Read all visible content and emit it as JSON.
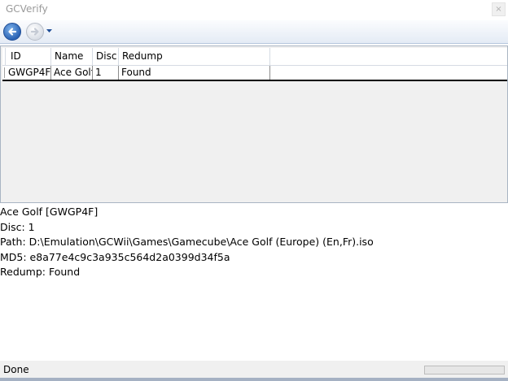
{
  "window": {
    "title": "GCVerify",
    "close_glyph": "×"
  },
  "toolbar": {
    "back_icon": "back-arrow-icon",
    "forward_icon": "forward-arrow-icon",
    "dropdown_icon": "chevron-down-icon"
  },
  "table": {
    "columns": [
      {
        "label": "ID"
      },
      {
        "label": "Name"
      },
      {
        "label": "Disc"
      },
      {
        "label": "Redump"
      }
    ],
    "rows": [
      {
        "id": "GWGP4F",
        "name": "Ace Golf",
        "disc": "1",
        "redump": "Found"
      }
    ]
  },
  "details": {
    "title_line": "Ace Golf [GWGP4F]",
    "disc_line": "Disc: 1",
    "path_line": "Path: D:\\Emulation\\GCWii\\Games\\Gamecube\\Ace Golf (Europe) (En,Fr).iso",
    "md5_line": "MD5: e8a77e4c9c3a935c564d2a0399d34f5a",
    "redump_line": "Redump: Found"
  },
  "status": {
    "text": "Done",
    "progress": 0
  },
  "colors": {
    "accent": "#2b63b4",
    "grid_background": "#f0f0f0",
    "progress_fill": "#06b025"
  }
}
